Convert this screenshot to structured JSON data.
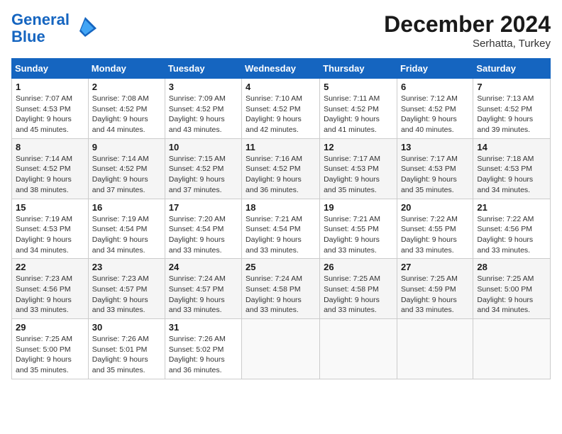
{
  "header": {
    "logo_line1": "General",
    "logo_line2": "Blue",
    "month_year": "December 2024",
    "location": "Serhatta, Turkey"
  },
  "weekdays": [
    "Sunday",
    "Monday",
    "Tuesday",
    "Wednesday",
    "Thursday",
    "Friday",
    "Saturday"
  ],
  "weeks": [
    [
      {
        "day": "1",
        "sunrise": "Sunrise: 7:07 AM",
        "sunset": "Sunset: 4:53 PM",
        "daylight": "Daylight: 9 hours and 45 minutes."
      },
      {
        "day": "2",
        "sunrise": "Sunrise: 7:08 AM",
        "sunset": "Sunset: 4:52 PM",
        "daylight": "Daylight: 9 hours and 44 minutes."
      },
      {
        "day": "3",
        "sunrise": "Sunrise: 7:09 AM",
        "sunset": "Sunset: 4:52 PM",
        "daylight": "Daylight: 9 hours and 43 minutes."
      },
      {
        "day": "4",
        "sunrise": "Sunrise: 7:10 AM",
        "sunset": "Sunset: 4:52 PM",
        "daylight": "Daylight: 9 hours and 42 minutes."
      },
      {
        "day": "5",
        "sunrise": "Sunrise: 7:11 AM",
        "sunset": "Sunset: 4:52 PM",
        "daylight": "Daylight: 9 hours and 41 minutes."
      },
      {
        "day": "6",
        "sunrise": "Sunrise: 7:12 AM",
        "sunset": "Sunset: 4:52 PM",
        "daylight": "Daylight: 9 hours and 40 minutes."
      },
      {
        "day": "7",
        "sunrise": "Sunrise: 7:13 AM",
        "sunset": "Sunset: 4:52 PM",
        "daylight": "Daylight: 9 hours and 39 minutes."
      }
    ],
    [
      {
        "day": "8",
        "sunrise": "Sunrise: 7:14 AM",
        "sunset": "Sunset: 4:52 PM",
        "daylight": "Daylight: 9 hours and 38 minutes."
      },
      {
        "day": "9",
        "sunrise": "Sunrise: 7:14 AM",
        "sunset": "Sunset: 4:52 PM",
        "daylight": "Daylight: 9 hours and 37 minutes."
      },
      {
        "day": "10",
        "sunrise": "Sunrise: 7:15 AM",
        "sunset": "Sunset: 4:52 PM",
        "daylight": "Daylight: 9 hours and 37 minutes."
      },
      {
        "day": "11",
        "sunrise": "Sunrise: 7:16 AM",
        "sunset": "Sunset: 4:52 PM",
        "daylight": "Daylight: 9 hours and 36 minutes."
      },
      {
        "day": "12",
        "sunrise": "Sunrise: 7:17 AM",
        "sunset": "Sunset: 4:53 PM",
        "daylight": "Daylight: 9 hours and 35 minutes."
      },
      {
        "day": "13",
        "sunrise": "Sunrise: 7:17 AM",
        "sunset": "Sunset: 4:53 PM",
        "daylight": "Daylight: 9 hours and 35 minutes."
      },
      {
        "day": "14",
        "sunrise": "Sunrise: 7:18 AM",
        "sunset": "Sunset: 4:53 PM",
        "daylight": "Daylight: 9 hours and 34 minutes."
      }
    ],
    [
      {
        "day": "15",
        "sunrise": "Sunrise: 7:19 AM",
        "sunset": "Sunset: 4:53 PM",
        "daylight": "Daylight: 9 hours and 34 minutes."
      },
      {
        "day": "16",
        "sunrise": "Sunrise: 7:19 AM",
        "sunset": "Sunset: 4:54 PM",
        "daylight": "Daylight: 9 hours and 34 minutes."
      },
      {
        "day": "17",
        "sunrise": "Sunrise: 7:20 AM",
        "sunset": "Sunset: 4:54 PM",
        "daylight": "Daylight: 9 hours and 33 minutes."
      },
      {
        "day": "18",
        "sunrise": "Sunrise: 7:21 AM",
        "sunset": "Sunset: 4:54 PM",
        "daylight": "Daylight: 9 hours and 33 minutes."
      },
      {
        "day": "19",
        "sunrise": "Sunrise: 7:21 AM",
        "sunset": "Sunset: 4:55 PM",
        "daylight": "Daylight: 9 hours and 33 minutes."
      },
      {
        "day": "20",
        "sunrise": "Sunrise: 7:22 AM",
        "sunset": "Sunset: 4:55 PM",
        "daylight": "Daylight: 9 hours and 33 minutes."
      },
      {
        "day": "21",
        "sunrise": "Sunrise: 7:22 AM",
        "sunset": "Sunset: 4:56 PM",
        "daylight": "Daylight: 9 hours and 33 minutes."
      }
    ],
    [
      {
        "day": "22",
        "sunrise": "Sunrise: 7:23 AM",
        "sunset": "Sunset: 4:56 PM",
        "daylight": "Daylight: 9 hours and 33 minutes."
      },
      {
        "day": "23",
        "sunrise": "Sunrise: 7:23 AM",
        "sunset": "Sunset: 4:57 PM",
        "daylight": "Daylight: 9 hours and 33 minutes."
      },
      {
        "day": "24",
        "sunrise": "Sunrise: 7:24 AM",
        "sunset": "Sunset: 4:57 PM",
        "daylight": "Daylight: 9 hours and 33 minutes."
      },
      {
        "day": "25",
        "sunrise": "Sunrise: 7:24 AM",
        "sunset": "Sunset: 4:58 PM",
        "daylight": "Daylight: 9 hours and 33 minutes."
      },
      {
        "day": "26",
        "sunrise": "Sunrise: 7:25 AM",
        "sunset": "Sunset: 4:58 PM",
        "daylight": "Daylight: 9 hours and 33 minutes."
      },
      {
        "day": "27",
        "sunrise": "Sunrise: 7:25 AM",
        "sunset": "Sunset: 4:59 PM",
        "daylight": "Daylight: 9 hours and 33 minutes."
      },
      {
        "day": "28",
        "sunrise": "Sunrise: 7:25 AM",
        "sunset": "Sunset: 5:00 PM",
        "daylight": "Daylight: 9 hours and 34 minutes."
      }
    ],
    [
      {
        "day": "29",
        "sunrise": "Sunrise: 7:25 AM",
        "sunset": "Sunset: 5:00 PM",
        "daylight": "Daylight: 9 hours and 35 minutes."
      },
      {
        "day": "30",
        "sunrise": "Sunrise: 7:26 AM",
        "sunset": "Sunset: 5:01 PM",
        "daylight": "Daylight: 9 hours and 35 minutes."
      },
      {
        "day": "31",
        "sunrise": "Sunrise: 7:26 AM",
        "sunset": "Sunset: 5:02 PM",
        "daylight": "Daylight: 9 hours and 36 minutes."
      },
      null,
      null,
      null,
      null
    ]
  ]
}
